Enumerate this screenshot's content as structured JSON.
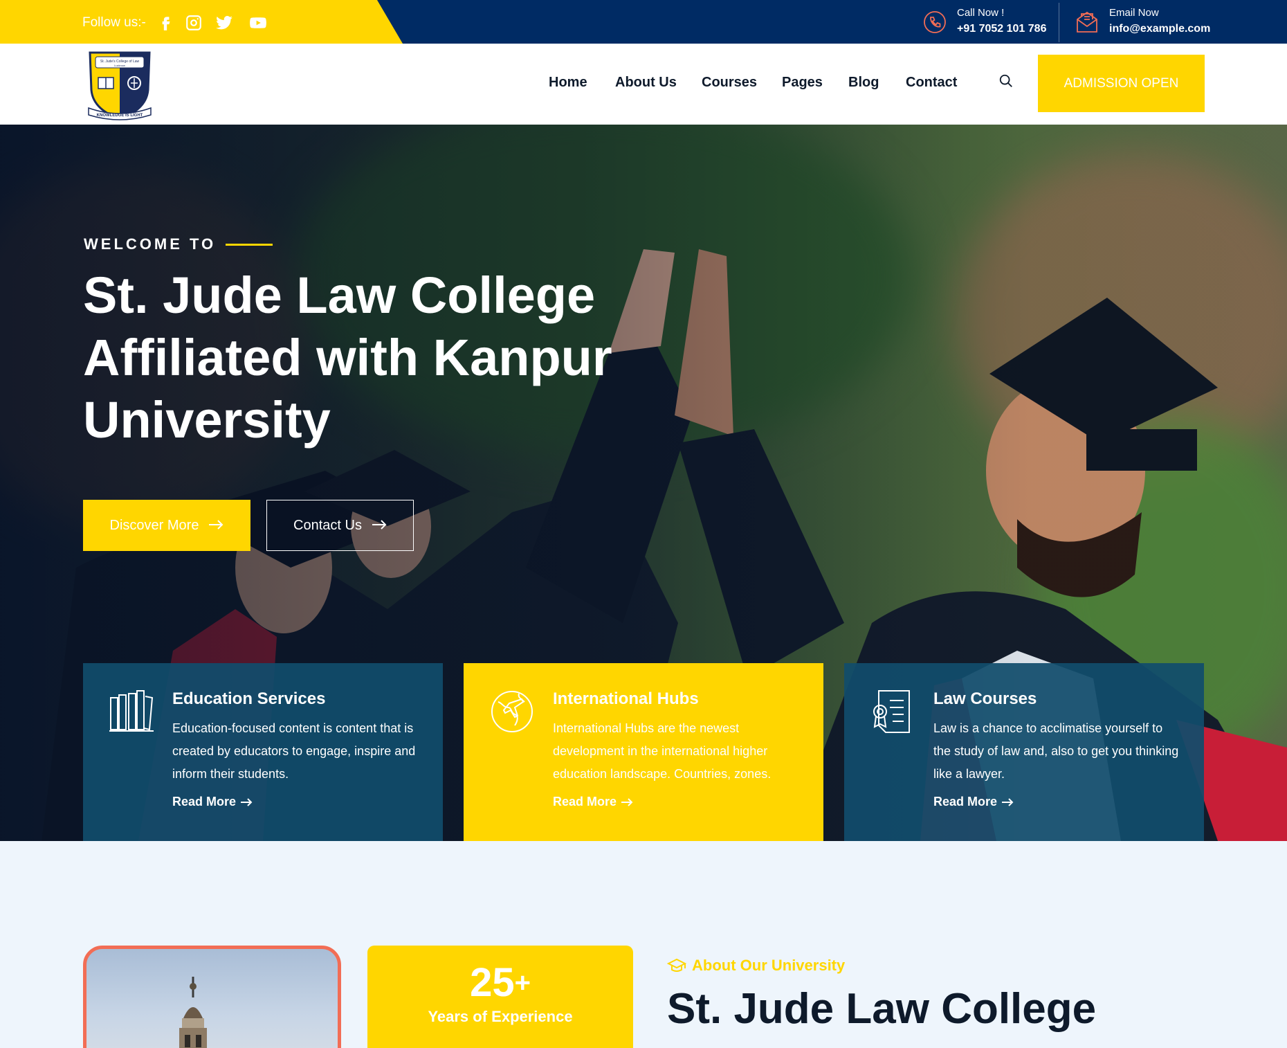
{
  "topbar": {
    "follow_label": "Follow us:-",
    "socials": [
      "facebook-icon",
      "instagram-icon",
      "twitter-icon",
      "youtube-icon"
    ],
    "call": {
      "label": "Call Now !",
      "value": "+91 7052 101 786"
    },
    "email": {
      "label": "Email Now",
      "value": "info@example.com"
    }
  },
  "header": {
    "logo": {
      "college_name": "St. Jude's College of Law",
      "location": "Lucknow",
      "motto": "KNOWLEDGE IS LIGHT"
    },
    "nav": [
      "Home",
      "About Us",
      "Courses",
      "Pages",
      "Blog",
      "Contact"
    ],
    "cta_label": "ADMISSION OPEN"
  },
  "hero": {
    "kicker": "WELCOME TO",
    "title_lines": [
      "St. Jude Law College",
      "Affiliated with Kanpur",
      "University"
    ],
    "primary_button": "Discover More",
    "secondary_button": "Contact Us"
  },
  "cards": [
    {
      "title": "Education Services",
      "text": "Education-focused content is content that is created by educators to engage, inspire and inform their students.",
      "link": "Read More",
      "icon": "books-icon"
    },
    {
      "title": "International Hubs",
      "text": "International Hubs are the newest development in the international higher education landscape. Countries, zones.",
      "link": "Read More",
      "icon": "globe-plane-icon"
    },
    {
      "title": "Law Courses",
      "text": "Law is a chance to acclimatise yourself to the study of law and, also to get you thinking like a lawyer.",
      "link": "Read More",
      "icon": "certificate-icon"
    }
  ],
  "about": {
    "experience_number": "25",
    "experience_suffix": "+",
    "experience_label": "Years of Experience",
    "kicker": "About Our University",
    "title": "St. Jude Law College"
  },
  "colors": {
    "navy": "#002b64",
    "yellow": "#ffd600",
    "card_blue": "#114c6c",
    "accent_orange": "#f26d55",
    "dark_text": "#0e1a2b"
  }
}
